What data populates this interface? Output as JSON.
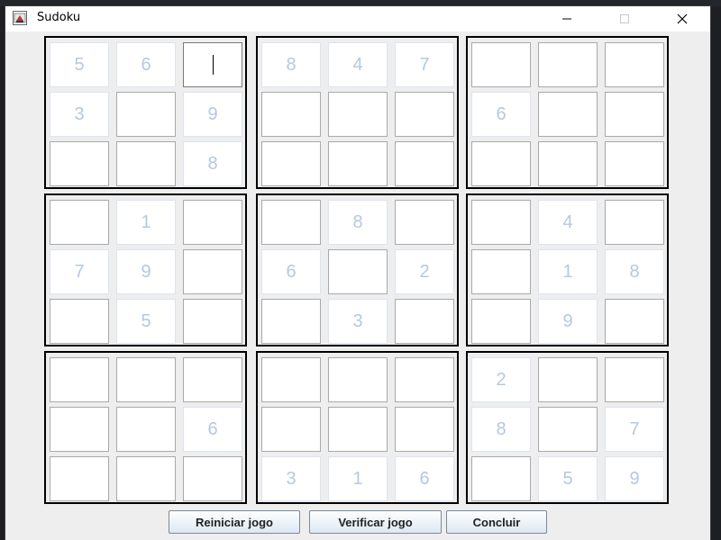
{
  "window": {
    "title": "Sudoku",
    "controls": [
      "minimize",
      "maximize",
      "close"
    ]
  },
  "board": {
    "cells": [
      [
        "5",
        "6",
        "",
        "8",
        "4",
        "7",
        "",
        "",
        ""
      ],
      [
        "3",
        "",
        "9",
        "",
        "",
        "",
        "6",
        "",
        ""
      ],
      [
        "",
        "",
        "8",
        "",
        "",
        "",
        "",
        "",
        ""
      ],
      [
        "",
        "1",
        "",
        "",
        "8",
        "",
        "",
        "4",
        ""
      ],
      [
        "7",
        "9",
        "",
        "6",
        "",
        "2",
        "",
        "1",
        "8"
      ],
      [
        "",
        "5",
        "",
        "",
        "3",
        "",
        "",
        "9",
        ""
      ],
      [
        "",
        "",
        "",
        "",
        "",
        "",
        "2",
        "",
        ""
      ],
      [
        "",
        "",
        "6",
        "",
        "",
        "",
        "8",
        "",
        "7"
      ],
      [
        "",
        "",
        "",
        "3",
        "1",
        "6",
        "",
        "5",
        "9"
      ]
    ],
    "active_cell": [
      0,
      2
    ]
  },
  "buttons": {
    "reset": "Reiniciar jogo",
    "verify": "Verificar jogo",
    "finish": "Concluir"
  },
  "colors": {
    "given_digit": "#b6c8df",
    "window_bg": "#eeeeee",
    "block_border": "#000000"
  }
}
